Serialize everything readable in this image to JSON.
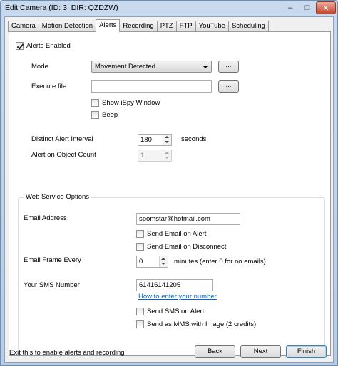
{
  "window": {
    "title": "Edit Camera (ID: 3, DIR: QZDZW)",
    "minimize_glyph": "–",
    "maximize_glyph": "□",
    "close_glyph": "✕"
  },
  "tabs": [
    {
      "label": "Camera",
      "active": false
    },
    {
      "label": "Motion Detection",
      "active": false
    },
    {
      "label": "Alerts",
      "active": true
    },
    {
      "label": "Recording",
      "active": false
    },
    {
      "label": "PTZ",
      "active": false
    },
    {
      "label": "FTP",
      "active": false
    },
    {
      "label": "YouTube",
      "active": false
    },
    {
      "label": "Scheduling",
      "active": false
    }
  ],
  "alerts": {
    "alerts_enabled_label": "Alerts Enabled",
    "alerts_enabled_checked": true,
    "mode_label": "Mode",
    "mode_value": "Movement Detected",
    "browse_label": "...",
    "execute_file_label": "Execute file",
    "execute_file_value": "",
    "show_window_label": "Show iSpy Window",
    "beep_label": "Beep",
    "interval_label": "Distinct Alert Interval",
    "interval_value": "180",
    "interval_unit": "seconds",
    "object_count_label": "Alert on Object Count",
    "object_count_value": "1"
  },
  "web_service": {
    "group_title": "Web Service Options",
    "email_label": "Email Address",
    "email_value": "spomstar@hotmail.com",
    "send_on_alert_label": "Send Email on Alert",
    "send_on_disconnect_label": "Send Email on Disconnect",
    "frame_every_label": "Email Frame Every",
    "frame_every_value": "0",
    "frame_every_unit": "minutes (enter 0 for no emails)",
    "sms_label": "Your SMS Number",
    "sms_value": "61416141205",
    "sms_help_link": "How to enter your number",
    "sms_on_alert_label": "Send SMS on Alert",
    "mms_label": "Send as MMS with Image (2 credits)"
  },
  "footer": {
    "hint": "Exit this to enable alerts and recording",
    "back_label": "Back",
    "next_label": "Next",
    "finish_label": "Finish"
  }
}
